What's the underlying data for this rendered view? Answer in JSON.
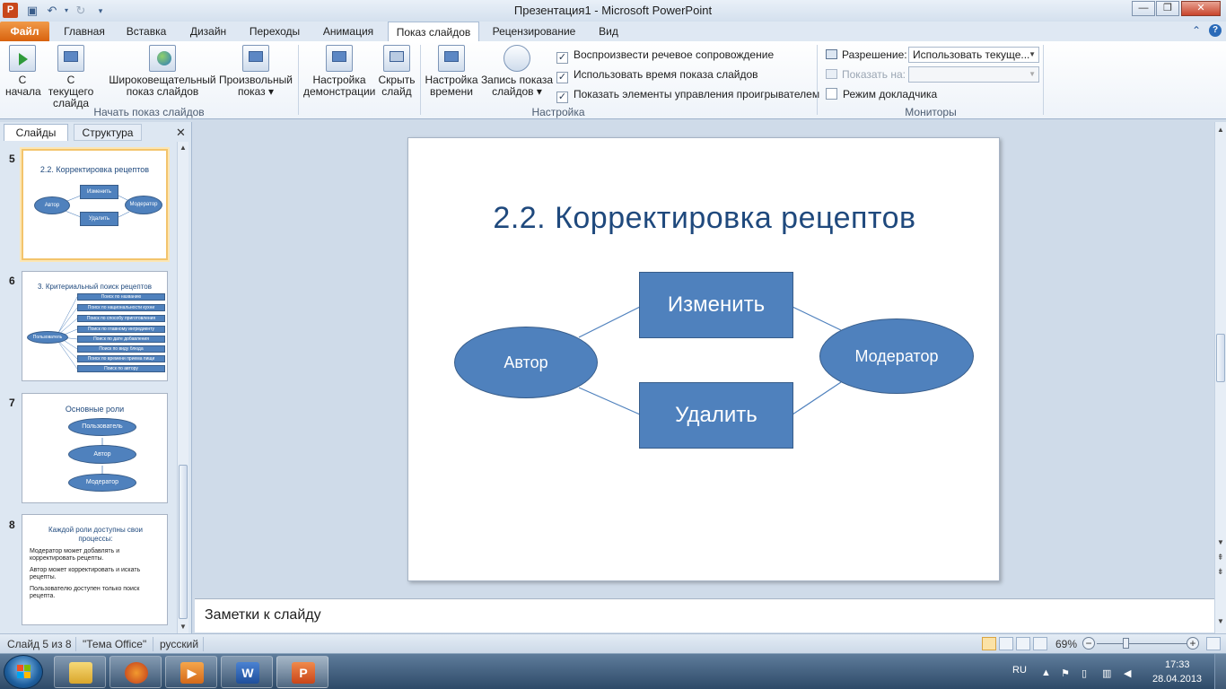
{
  "window": {
    "title": "Презентация1  -  Microsoft PowerPoint",
    "app_letter": "P",
    "minimize": "—",
    "maximize": "❐",
    "close": "✕"
  },
  "ribbon_tabs": [
    "Файл",
    "Главная",
    "Вставка",
    "Дизайн",
    "Переходы",
    "Анимация",
    "Показ слайдов",
    "Рецензирование",
    "Вид"
  ],
  "active_tab": "Показ слайдов",
  "ribbon": {
    "start_group": {
      "label": "Начать показ слайдов",
      "buttons": {
        "from_start": [
          "С",
          "начала"
        ],
        "from_current": [
          "С текущего",
          "слайда"
        ],
        "broadcast": [
          "Широковещательный",
          "показ слайдов"
        ],
        "custom": [
          "Произвольный",
          "показ ▾"
        ]
      }
    },
    "setup_group": {
      "label": "Настройка",
      "buttons": {
        "setup": [
          "Настройка",
          "демонстрации"
        ],
        "hide": [
          "Скрыть",
          "слайд"
        ],
        "timings": [
          "Настройка",
          "времени"
        ],
        "record": [
          "Запись показа",
          "слайдов ▾"
        ]
      },
      "checkboxes": [
        {
          "label": "Воспроизвести речевое сопровождение",
          "checked": true
        },
        {
          "label": "Использовать время показа слайдов",
          "checked": true
        },
        {
          "label": "Показать элементы управления проигрывателем",
          "checked": true
        }
      ]
    },
    "monitors_group": {
      "label": "Мониторы",
      "resolution_label": "Разрешение:",
      "resolution_value": "Использовать текуще...",
      "show_on_label": "Показать на:",
      "show_on_value": "",
      "presenter_view_label": "Режим докладчика",
      "presenter_view_checked": false
    }
  },
  "panel": {
    "tab_slides": "Слайды",
    "tab_outline": "Структура",
    "close": "✕",
    "thumbnails": [
      {
        "num": "5",
        "title": "2.2. Корректировка рецептов",
        "shapes": [
          "Автор",
          "Изменить",
          "Удалить",
          "Модератор"
        ]
      },
      {
        "num": "6",
        "title": "3. Критериальный поиск рецептов",
        "root": "Пользователь",
        "items": [
          "Поиск по названию",
          "Поиск по национальности кухни",
          "Поиск по способу приготовления",
          "Поиск по главному ингредиенту",
          "Поиск по дате добавления",
          "Поиск по виду блюда",
          "Поиск по времени приема пищи",
          "Поиск по автору"
        ]
      },
      {
        "num": "7",
        "title": "Основные роли",
        "shapes": [
          "Пользователь",
          "Автор",
          "Модератор"
        ]
      },
      {
        "num": "8",
        "title": "Каждой роли доступны свои процессы:",
        "lines": [
          "Модератор может добавлять и корректировать рецепты.",
          "Автор может корректировать и искать рецепты.",
          "Пользователю доступен только поиск рецепта."
        ]
      }
    ]
  },
  "slide": {
    "title": "2.2. Корректировка рецептов",
    "author": "Автор",
    "edit": "Изменить",
    "delete": "Удалить",
    "moderator": "Модератор"
  },
  "notes_placeholder": "Заметки к слайду",
  "status": {
    "slide_info": "Слайд 5 из 8",
    "theme": "\"Тема Office\"",
    "language": "русский",
    "zoom": "69%",
    "zoom_minus": "−",
    "zoom_plus": "+"
  },
  "taskbar": {
    "lang": "RU",
    "time": "17:33",
    "date": "28.04.2013",
    "word_letter": "W",
    "ppt_letter": "P"
  },
  "colors": {
    "shape_fill": "#4f81bd",
    "shape_border": "#385d8a",
    "title_color": "#1f497d",
    "file_tab": "#d8620e"
  }
}
